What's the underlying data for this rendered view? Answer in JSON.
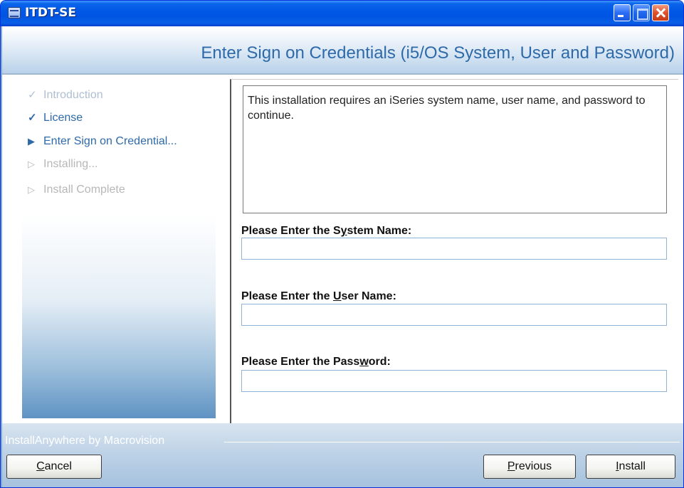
{
  "window": {
    "title": "ITDT-SE"
  },
  "header": {
    "title": "Enter Sign on Credentials (i5/OS System, User and Password)"
  },
  "steps": [
    {
      "label": "Introduction",
      "state": "done-faded",
      "glyph": "✓"
    },
    {
      "label": "License",
      "state": "done",
      "glyph": "✓"
    },
    {
      "label": "Enter Sign on Credential...",
      "state": "current",
      "glyph": "▶"
    },
    {
      "label": "Installing...",
      "state": "pending",
      "glyph": "▷"
    },
    {
      "label": "Install Complete",
      "state": "pending",
      "glyph": "▷"
    }
  ],
  "content": {
    "info_text": "This installation requires an iSeries system name, user name, and password to continue.",
    "fields": [
      {
        "label_pre": "Please Enter the S",
        "label_mnemonic": "y",
        "label_post": "stem Name:",
        "value": ""
      },
      {
        "label_pre": "Please Enter the ",
        "label_mnemonic": "U",
        "label_post": "ser Name:",
        "value": ""
      },
      {
        "label_pre": "Please Enter the Pass",
        "label_mnemonic": "w",
        "label_post": "ord:",
        "value": ""
      }
    ]
  },
  "footer": {
    "brand": "InstallAnywhere by Macrovision",
    "cancel": {
      "mnemonic": "C",
      "rest": "ancel"
    },
    "previous": {
      "mnemonic": "P",
      "rest": "revious"
    },
    "install": {
      "mnemonic": "I",
      "rest": "nstall"
    }
  },
  "colors": {
    "titlebar": "#0054e3",
    "heading": "#2e6aa9",
    "step_done": "#2e6aa9",
    "step_pending": "#b7b7b7"
  }
}
